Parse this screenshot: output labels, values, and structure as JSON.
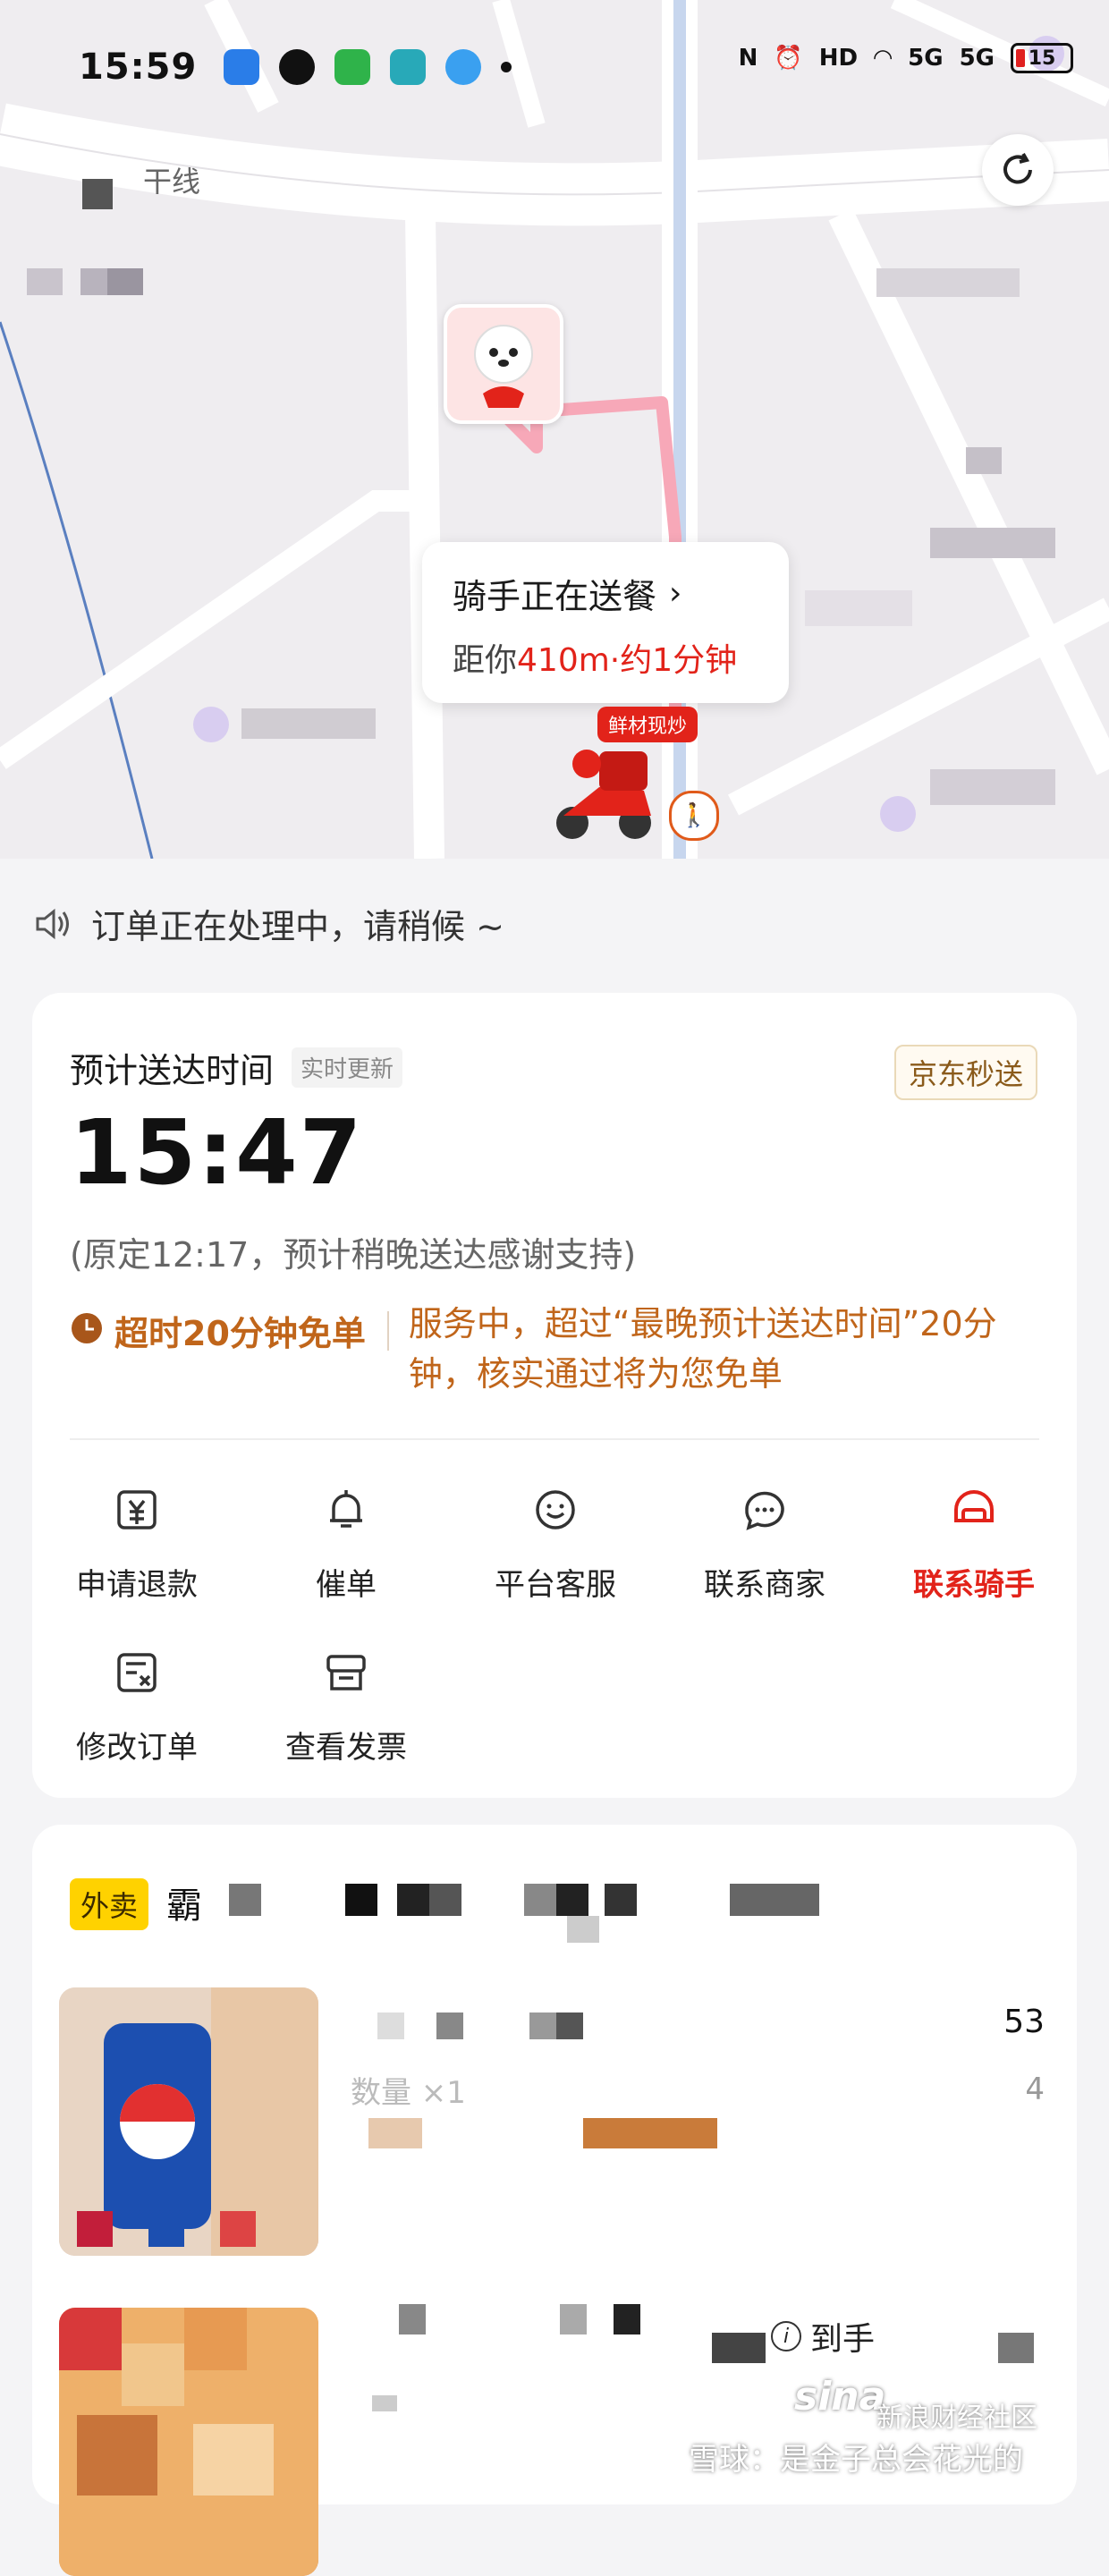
{
  "status_bar": {
    "time": "15:59",
    "battery": "15",
    "network_labels": [
      "HD",
      "5G",
      "5G"
    ]
  },
  "map": {
    "road_label": "干线",
    "rider_card": {
      "title": "骑手正在送餐",
      "distance_prefix": "距你",
      "distance_highlight": "410m·约1分钟"
    },
    "rider_tag": "鲜材现炒"
  },
  "notice": "订单正在处理中，请稍候 ~",
  "order_card": {
    "eta_label": "预计送达时间",
    "realtime_chip": "实时更新",
    "brand_tag": "京东秒送",
    "eta_time": "15:47",
    "eta_note": "(原定12:17，预计稍晚送达感谢支持)",
    "promise_left": "超时20分钟免单",
    "promise_right": "服务中，超过“最晚预计送达时间”20分钟，核实通过将为您免单",
    "actions": [
      {
        "label": "申请退款",
        "icon": "refund-icon"
      },
      {
        "label": "催单",
        "icon": "bell-icon"
      },
      {
        "label": "平台客服",
        "icon": "service-icon"
      },
      {
        "label": "联系商家",
        "icon": "merchant-chat-icon"
      },
      {
        "label": "联系骑手",
        "icon": "rider-helmet-icon"
      },
      {
        "label": "修改订单",
        "icon": "edit-order-icon"
      },
      {
        "label": "查看发票",
        "icon": "invoice-icon"
      }
    ]
  },
  "shop_card": {
    "tag": "外卖",
    "shop_name_partial": "霸",
    "item1": {
      "qty_label": "数量 ×1",
      "price_tail": "53",
      "right_tail": "4"
    },
    "arrive_label": "到手"
  },
  "watermark": {
    "logo": "sina",
    "community": "新浪财经社区",
    "user": "雪球：是金子总会花光的"
  },
  "colors": {
    "accent_red": "#e2231a",
    "promise_orange": "#c0651a",
    "shop_tag_yellow": "#ffd200"
  }
}
